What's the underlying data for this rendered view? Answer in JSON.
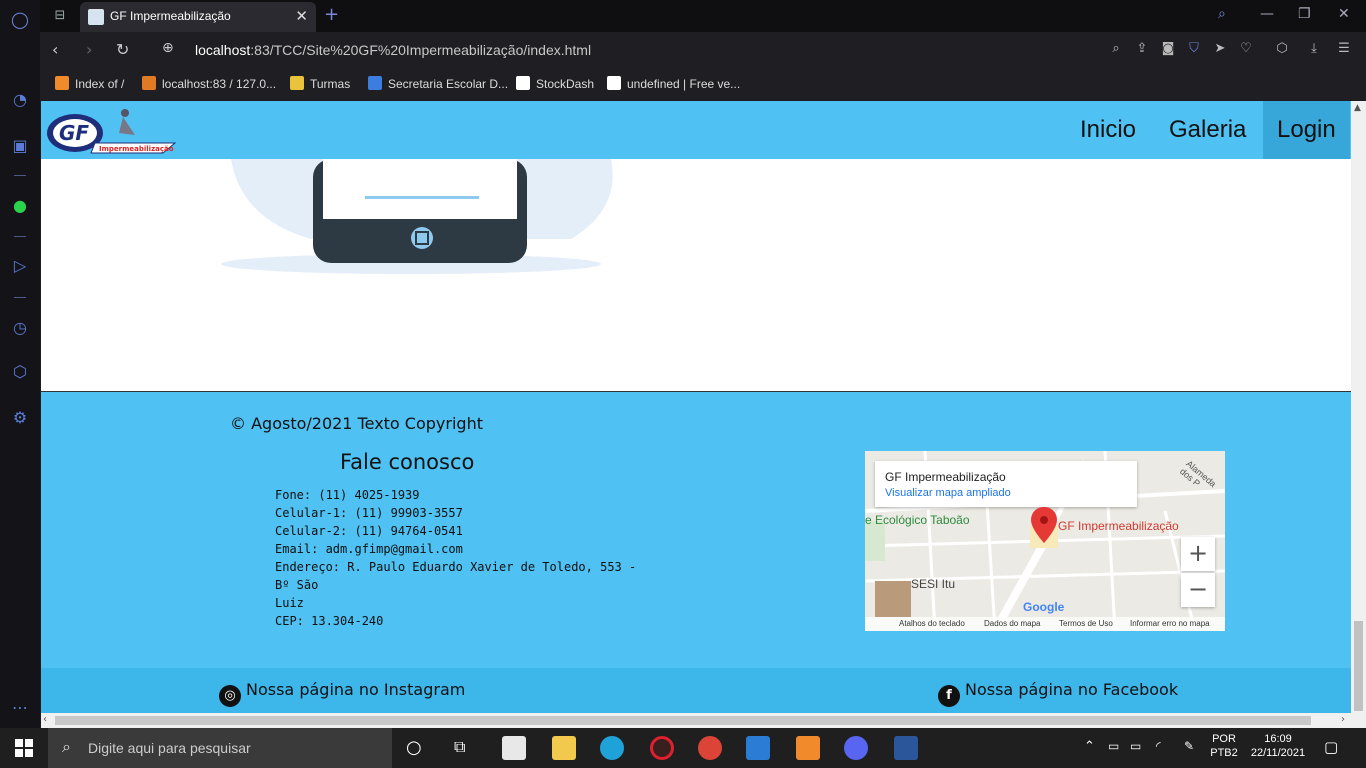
{
  "browser": {
    "tab_title": "GF Impermeabilização",
    "url_host": "localhost",
    "url_path": ":83/TCC/Site%20GF%20Impermeabilização/index.html",
    "bookmarks": [
      "Index of /",
      "localhost:83 / 127.0...",
      "Turmas",
      "Secretaria Escolar D...",
      "StockDash",
      "undefined | Free ve..."
    ]
  },
  "site": {
    "nav": [
      "Inicio",
      "Galeria",
      "Login"
    ],
    "logo_brand": "GF",
    "logo_sub": "Impermeabilização"
  },
  "footer": {
    "copyright": "© Agosto/2021 Texto Copyright",
    "contact_title": "Fale conosco",
    "contact_lines": [
      "Fone: (11) 4025-1939",
      "Celular-1: (11) 99903-3557",
      "Celular-2: (11) 94764-0541",
      "Email: adm.gfimp@gmail.com",
      "Endereço: R. Paulo Eduardo Xavier de Toledo, 553 - Bº São",
      "Luiz",
      "CEP: 13.304-240"
    ],
    "instagram": "Nossa página no Instagram",
    "facebook": "Nossa página no Facebook"
  },
  "map": {
    "place_title": "GF Impermeabilização",
    "view_larger": "Visualizar mapa ampliado",
    "pin_label": "GF Impermeabilização",
    "park_label": "e Ecológico Taboão",
    "sesi_label": "SESI Itu",
    "street_label": "Alameda dos P",
    "google": "Google",
    "footer_links": [
      "Atalhos do teclado",
      "Dados do mapa",
      "Termos de Uso",
      "Informar erro no mapa"
    ]
  },
  "taskbar": {
    "search_placeholder": "Digite aqui para pesquisar",
    "lang_top": "POR",
    "lang_bottom": "PTB2",
    "time": "16:09",
    "date": "22/11/2021"
  }
}
